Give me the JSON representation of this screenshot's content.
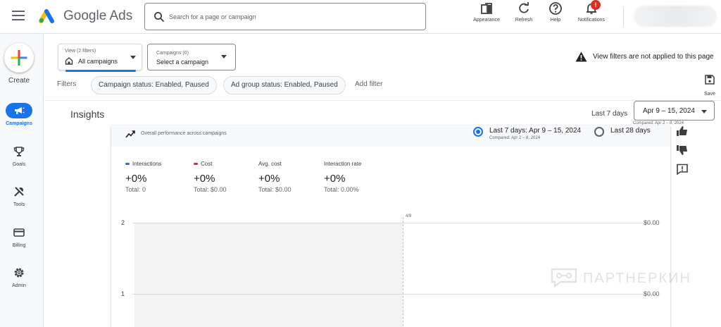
{
  "header": {
    "brand": "Google Ads",
    "search_placeholder": "Search for a page or campaign",
    "buttons": [
      {
        "label": "Appearance",
        "icon": "appearance-icon"
      },
      {
        "label": "Refresh",
        "icon": "refresh-icon"
      },
      {
        "label": "Help",
        "icon": "help-icon"
      },
      {
        "label": "Notifications",
        "icon": "bell-icon",
        "badge": "!"
      }
    ]
  },
  "sidenav": {
    "create_label": "Create",
    "items": [
      {
        "label": "Campaigns",
        "icon": "megaphone-icon",
        "active": true
      },
      {
        "label": "Goals",
        "icon": "trophy-icon"
      },
      {
        "label": "Tools",
        "icon": "tools-icon"
      },
      {
        "label": "Billing",
        "icon": "credit-card-icon"
      },
      {
        "label": "Admin",
        "icon": "gear-icon"
      }
    ]
  },
  "view_selector": {
    "caption": "View (2 filters)",
    "value": "All campaigns"
  },
  "campaign_selector": {
    "caption": "Campaigns (0)",
    "value": "Select a campaign"
  },
  "warning": {
    "text": "View filters are not applied to this page"
  },
  "filters": {
    "label": "Filters",
    "chips": [
      "Campaign status: Enabled, Paused",
      "Ad group status: Enabled, Paused"
    ],
    "add_filter": "Add filter"
  },
  "save": {
    "label": "Save"
  },
  "insights": {
    "title": "Insights",
    "range_label": "Last 7 days",
    "date_range": "Apr 9 – 15, 2024",
    "compared": "Compared: Apr 2 – 8, 2024"
  },
  "card": {
    "subtitle": "Overall performance across campaigns",
    "options": [
      {
        "label": "Last 7 days: Apr 9 – 15, 2024",
        "sub": "Compared: Apr 2 – 8, 2024",
        "selected": true
      },
      {
        "label": "Last 28 days",
        "sub": "",
        "selected": false
      }
    ],
    "metrics": [
      {
        "name": "Interactions",
        "value": "+0%",
        "total": "Total: 0",
        "color": "#1a73e8"
      },
      {
        "name": "Cost",
        "value": "+0%",
        "total": "Total: $0.00",
        "color": "#d93025"
      },
      {
        "name": "Avg. cost",
        "value": "+0%",
        "total": "Total: $0.00",
        "color": ""
      },
      {
        "name": "Interaction rate",
        "value": "+0%",
        "total": "Total: 0.00%",
        "color": ""
      }
    ],
    "chart": {
      "date_tick": "4/9",
      "y_left": [
        "2",
        "1"
      ],
      "y_right": [
        "$0.00",
        "$0.00"
      ]
    }
  },
  "watermark": {
    "text": "ПАРТНЕРКИН"
  },
  "colors": {
    "accent": "#1a73e8",
    "alert": "#d93025"
  }
}
